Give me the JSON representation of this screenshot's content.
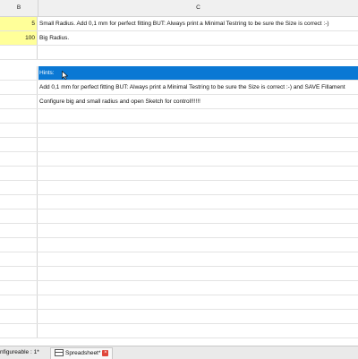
{
  "columns": {
    "b": "B",
    "c": "C"
  },
  "rows": [
    {
      "b": "5",
      "c": "Small Radius. Add 0,1 mm for perfect fitting BUT: Always print a Minimal Testring to be sure the Size is correct :-)",
      "highlight": "yellow"
    },
    {
      "b": "100",
      "c": "Big Radius.",
      "highlight": "yellow"
    },
    {
      "b": "",
      "c": ""
    },
    {
      "b": "",
      "c": "Hints:",
      "highlight": "selected"
    },
    {
      "b": "",
      "c": " Add 0,1 mm for perfect fitting BUT: Always print a Minimal Testring to be sure the Size is correct :-) and SAVE Fillament"
    },
    {
      "b": "",
      "c": "Configure big and small radius and open Sketch for control!!!!!!"
    }
  ],
  "tabs": [
    {
      "label": "nfigureable : 1*"
    },
    {
      "label": "Spreadsheet*"
    }
  ],
  "colors": {
    "selected": "#0a78d4",
    "yellow": "#ffff99"
  }
}
